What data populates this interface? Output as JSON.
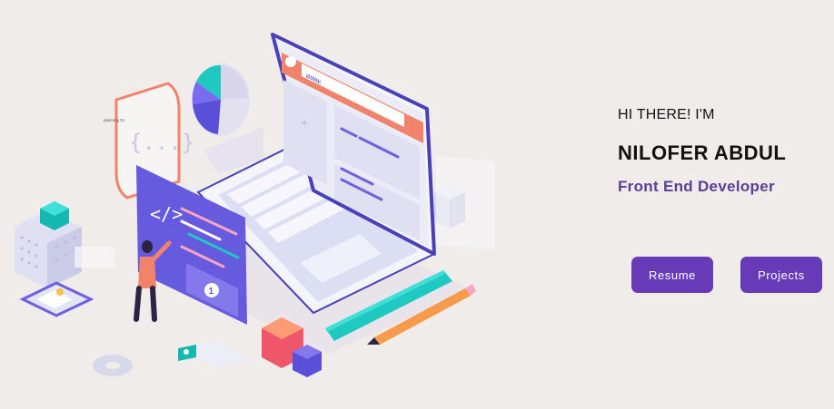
{
  "hero": {
    "greeting": "HI THERE! I'M",
    "name": "NILOFER ABDUL",
    "role": "Front End Developer"
  },
  "buttons": {
    "resume_label": "Resume",
    "projects_label": "Projects"
  },
  "illustration": {
    "browser_url_text": "www.",
    "card_label": "planning 01",
    "code_symbol": "{...}",
    "code_tag": "</>",
    "badge_number": "1"
  },
  "colors": {
    "accent": "#673ab7",
    "role_text": "#5c3d97",
    "background": "#f0ecea"
  }
}
